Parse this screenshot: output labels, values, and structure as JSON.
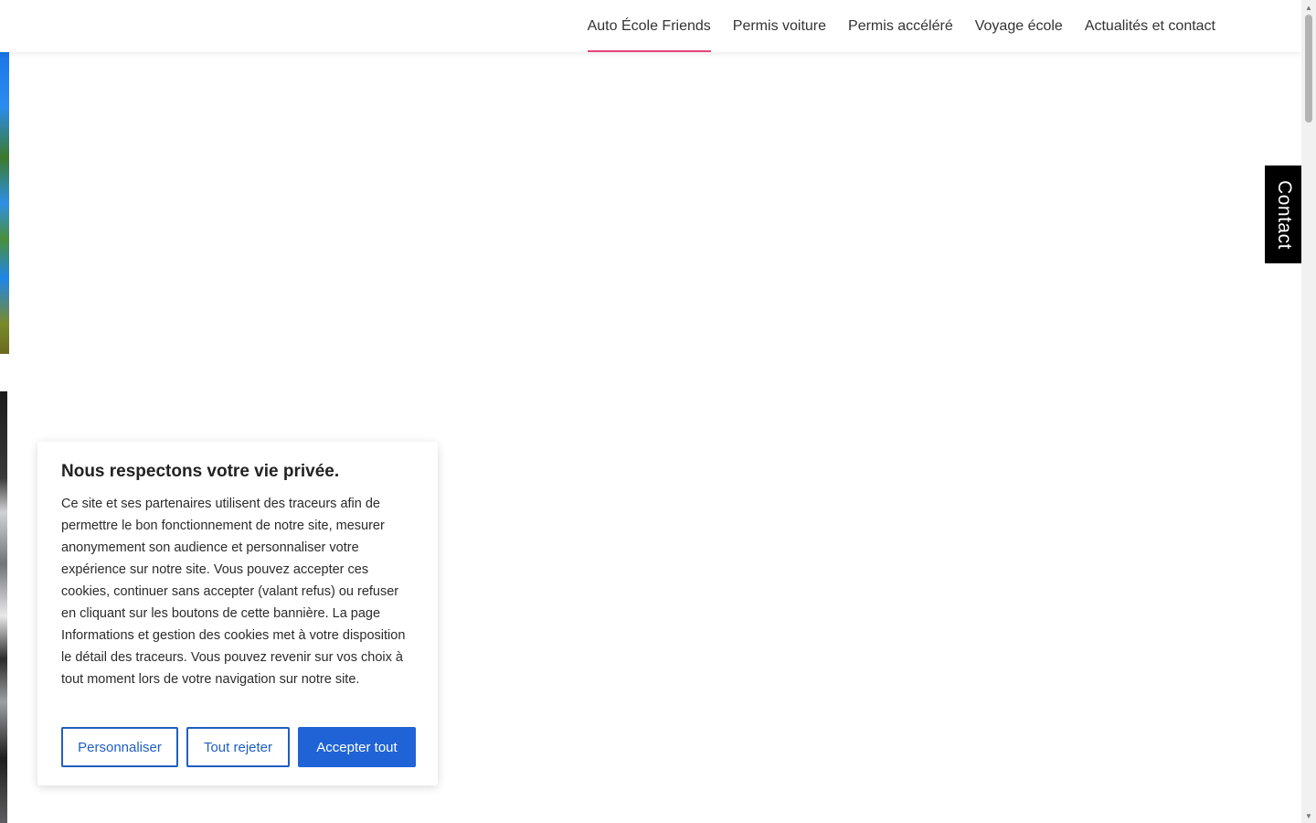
{
  "header": {
    "nav": [
      {
        "label": "Auto École Friends",
        "active": true
      },
      {
        "label": "Permis voiture",
        "active": false
      },
      {
        "label": "Permis accéléré",
        "active": false
      },
      {
        "label": "Voyage école",
        "active": false
      },
      {
        "label": "Actualités et contact",
        "active": false
      }
    ],
    "active_color": "#e5457a"
  },
  "contact_tab": {
    "label": "Contact"
  },
  "cookie_banner": {
    "title": "Nous respectons votre vie privée.",
    "body": "Ce site et ses partenaires utilisent des traceurs afin de permettre le bon fonctionnement de notre site, mesurer anonymement son audience et personnaliser votre expérience sur notre site. Vous pouvez accepter ces cookies, continuer sans accepter (valant refus) ou refuser en cliquant sur les boutons de cette bannière. La page Informations et gestion des cookies met à votre disposition le détail des traceurs. Vous pouvez revenir sur vos choix à tout moment lors de votre navigation sur notre site.",
    "buttons": {
      "customize": "Personnaliser",
      "reject_all": "Tout rejeter",
      "accept_all": "Accepter tout"
    },
    "accent_color": "#1f63d6"
  },
  "scrollbar": {
    "up_icon": "triangle-up-icon",
    "down_icon": "triangle-down-icon"
  }
}
